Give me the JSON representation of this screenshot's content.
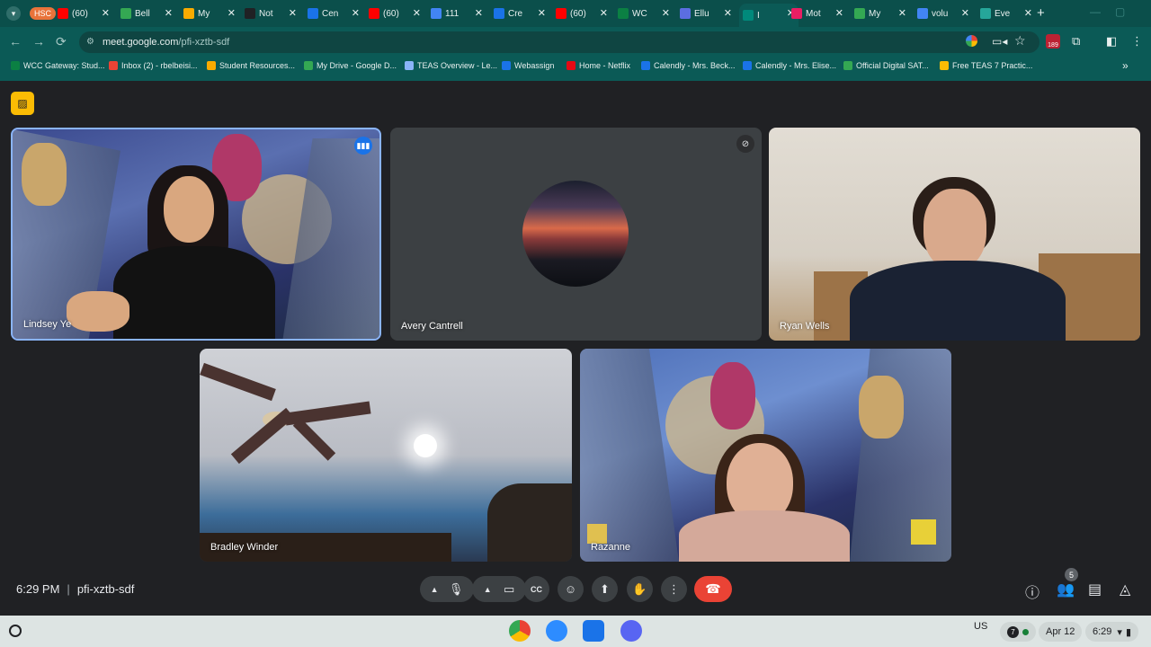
{
  "browser": {
    "tabs": [
      {
        "label": "HSC",
        "color": "#e8733a"
      },
      {
        "label": "(60)",
        "color": "#ff0000"
      },
      {
        "label": "Bell",
        "color": "#34a853"
      },
      {
        "label": "My",
        "color": "#f9ab00"
      },
      {
        "label": "Not",
        "color": "#202124"
      },
      {
        "label": "Cen",
        "color": "#1a73e8"
      },
      {
        "label": "(60)",
        "color": "#ff0000"
      },
      {
        "label": "111",
        "color": "#4285f4"
      },
      {
        "label": "Cre",
        "color": "#1a73e8"
      },
      {
        "label": "(60)",
        "color": "#ff0000"
      },
      {
        "label": "WC",
        "color": "#0b8043"
      },
      {
        "label": "Ellu",
        "color": "#5b6ee1"
      },
      {
        "label": "I",
        "color": "#00897b",
        "active": true
      },
      {
        "label": "Mot",
        "color": "#e91e63"
      },
      {
        "label": "My",
        "color": "#34a853"
      },
      {
        "label": "volu",
        "color": "#4285f4"
      },
      {
        "label": "Eve",
        "color": "#26a69a"
      }
    ],
    "url_host": "meet.google.com",
    "url_path": "/pfi-xztb-sdf",
    "bookmarks": [
      {
        "label": "WCC Gateway: Stud...",
        "color": "#0b8043"
      },
      {
        "label": "Inbox (2) - rbelbeisi...",
        "color": "#ea4335"
      },
      {
        "label": "Student Resources...",
        "color": "#f9ab00"
      },
      {
        "label": "My Drive - Google D...",
        "color": "#34a853"
      },
      {
        "label": "TEAS Overview - Le...",
        "color": "#8ab4f8"
      },
      {
        "label": "Webassign",
        "color": "#1a73e8"
      },
      {
        "label": "Home - Netflix",
        "color": "#e50914"
      },
      {
        "label": "Calendly - Mrs. Beck...",
        "color": "#1a73e8"
      },
      {
        "label": "Calendly - Mrs. Elise...",
        "color": "#1a73e8"
      },
      {
        "label": "Official Digital SAT...",
        "color": "#34a853"
      },
      {
        "label": "Free TEAS 7 Practic...",
        "color": "#fbbc04"
      }
    ]
  },
  "meet": {
    "participants": [
      {
        "name": "Lindsey Ye",
        "speaking": true
      },
      {
        "name": "Avery Cantrell",
        "muted": true
      },
      {
        "name": "Ryan Wells"
      },
      {
        "name": "Bradley Winder"
      },
      {
        "name": "Razanne"
      }
    ],
    "time": "6:29 PM",
    "meeting_code": "pfi-xztb-sdf",
    "participant_count": "5"
  },
  "shelf": {
    "locale": "US",
    "notif_count": "7",
    "date": "Apr 12",
    "clock": "6:29"
  }
}
